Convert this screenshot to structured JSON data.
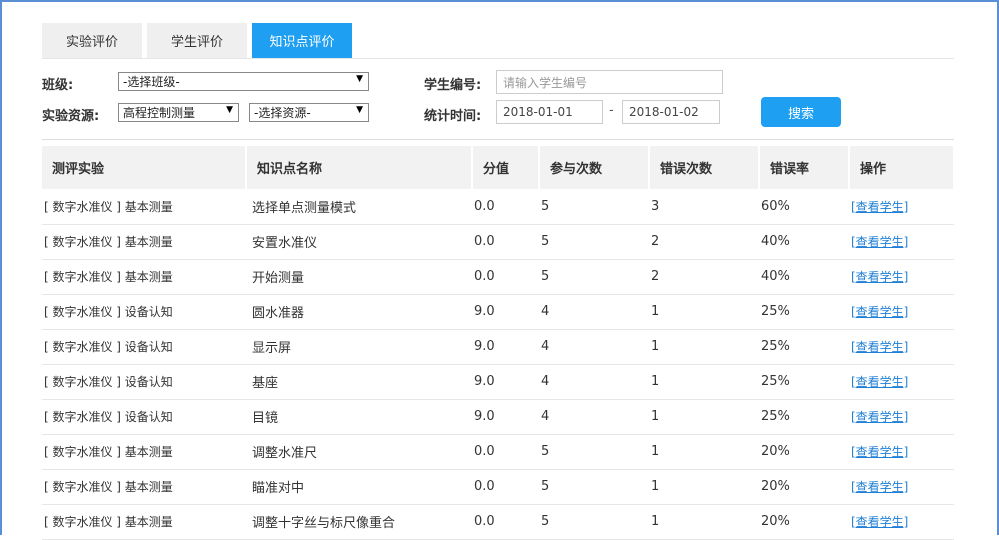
{
  "tabs": [
    {
      "label": "实验评价",
      "active": false
    },
    {
      "label": "学生评价",
      "active": false
    },
    {
      "label": "知识点评价",
      "active": true
    }
  ],
  "filters": {
    "class_label": "班级:",
    "class_value": "-选择班级-",
    "resource_label": "实验资源:",
    "resource_value": "高程控制测量",
    "resource2_value": "-选择资源-",
    "student_label": "学生编号:",
    "student_placeholder": "请输入学生编号",
    "time_label": "统计时间:",
    "date_from": "2018-01-01",
    "date_to": "2018-01-02",
    "search_label": "搜索"
  },
  "table": {
    "headers": [
      "测评实验",
      "知识点名称",
      "分值",
      "参与次数",
      "错误次数",
      "错误率",
      "操作"
    ],
    "action_label": "[查看学生]",
    "rows": [
      [
        "[ 数字水准仪 ] 基本测量",
        "选择单点测量模式",
        "0.0",
        "5",
        "3",
        "60%"
      ],
      [
        "[ 数字水准仪 ] 基本测量",
        "安置水准仪",
        "0.0",
        "5",
        "2",
        "40%"
      ],
      [
        "[ 数字水准仪 ] 基本测量",
        "开始测量",
        "0.0",
        "5",
        "2",
        "40%"
      ],
      [
        "[ 数字水准仪 ] 设备认知",
        "圆水准器",
        "9.0",
        "4",
        "1",
        "25%"
      ],
      [
        "[ 数字水准仪 ] 设备认知",
        "显示屏",
        "9.0",
        "4",
        "1",
        "25%"
      ],
      [
        "[ 数字水准仪 ] 设备认知",
        "基座",
        "9.0",
        "4",
        "1",
        "25%"
      ],
      [
        "[ 数字水准仪 ] 设备认知",
        "目镜",
        "9.0",
        "4",
        "1",
        "25%"
      ],
      [
        "[ 数字水准仪 ] 基本测量",
        "调整水准尺",
        "0.0",
        "5",
        "1",
        "20%"
      ],
      [
        "[ 数字水准仪 ] 基本测量",
        "瞄准对中",
        "0.0",
        "5",
        "1",
        "20%"
      ],
      [
        "[ 数字水准仪 ] 基本测量",
        "调整十字丝与标尺像重合",
        "0.0",
        "5",
        "1",
        "20%"
      ]
    ]
  },
  "colors": {
    "accent": "#1e9ff2",
    "frame": "#5a8fd6",
    "header_bg": "#f2f2f2"
  }
}
